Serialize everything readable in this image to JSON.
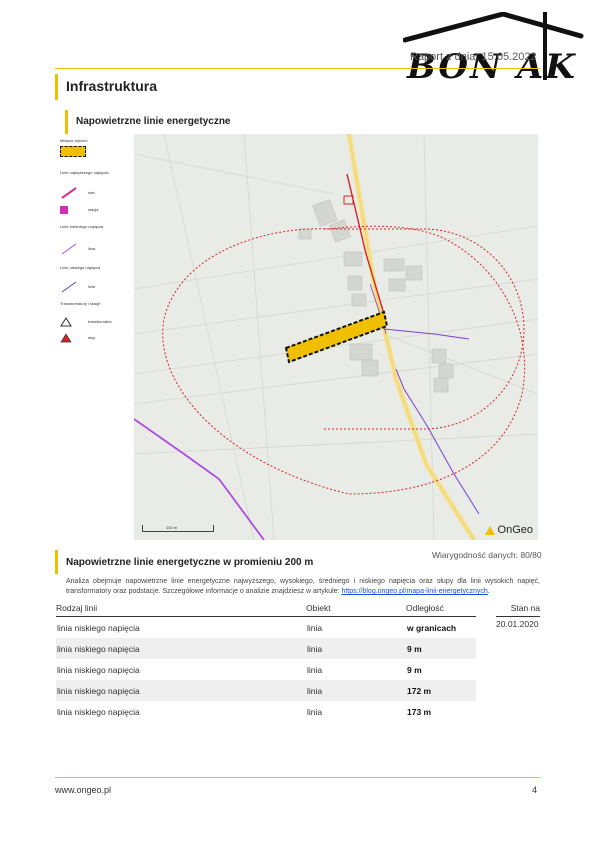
{
  "header": {
    "report_date": "Raport z dnia: 15.05.2022",
    "logo_text": "BON AK"
  },
  "section": {
    "title": "Infrastruktura",
    "subtitle": "Napowietrzne linie energetyczne"
  },
  "legend": {
    "plot_label": "Miejsce wyboru",
    "lines_header": "Linie najwyższego napięcia",
    "line_a": "sieć",
    "line_b": "stacja",
    "medium_header": "Linie średniego napięcia",
    "medium_item": "linia",
    "low_header": "Linie niskiego napięcia",
    "low_item": "linia",
    "transformers_header": "Transformatory i stacje",
    "transformer_item": "transformator",
    "pole_item": "słup"
  },
  "map": {
    "scale_label": "100 m",
    "brand": "OnGeo",
    "colors": {
      "background": "#e9ebe7",
      "road": "#f7e08a",
      "high_voltage": "#b04be0",
      "buffer": "#d2232a",
      "plot_border": "#111111",
      "plot_fill": "#f0c000"
    }
  },
  "results": {
    "title": "Napowietrzne linie energetyczne w promieniu 200 m",
    "reliability": "Wiarygodność danych: 80/80",
    "description": "Analiza obejmuje napowietrzne linie energetyczne najwyższego, wysokiego, średniego i niskiego napięcia oraz słupy dla linii wysokich napięć, transformatory oraz podstacje. Szczegółowe informacje o analizie znajdziesz w artykule:",
    "link_text": "https://blog.ongeo.pl/mapa-linii-energetycznych",
    "columns": [
      "Rodzaj linii",
      "Obiekt",
      "Odległość",
      "Stan na"
    ],
    "stan_date": "20.01.2020",
    "rows": [
      {
        "type": "linia niskiego napięcia",
        "object": "linia",
        "distance": "w granicach"
      },
      {
        "type": "linia niskiego napięcia",
        "object": "linia",
        "distance": "9 m"
      },
      {
        "type": "linia niskiego napięcia",
        "object": "linia",
        "distance": "9 m"
      },
      {
        "type": "linia niskiego napięcia",
        "object": "linia",
        "distance": "172 m"
      },
      {
        "type": "linia niskiego napięcia",
        "object": "linia",
        "distance": "173 m"
      }
    ]
  },
  "footer": {
    "url": "www.ongeo.pl",
    "page": "4"
  }
}
